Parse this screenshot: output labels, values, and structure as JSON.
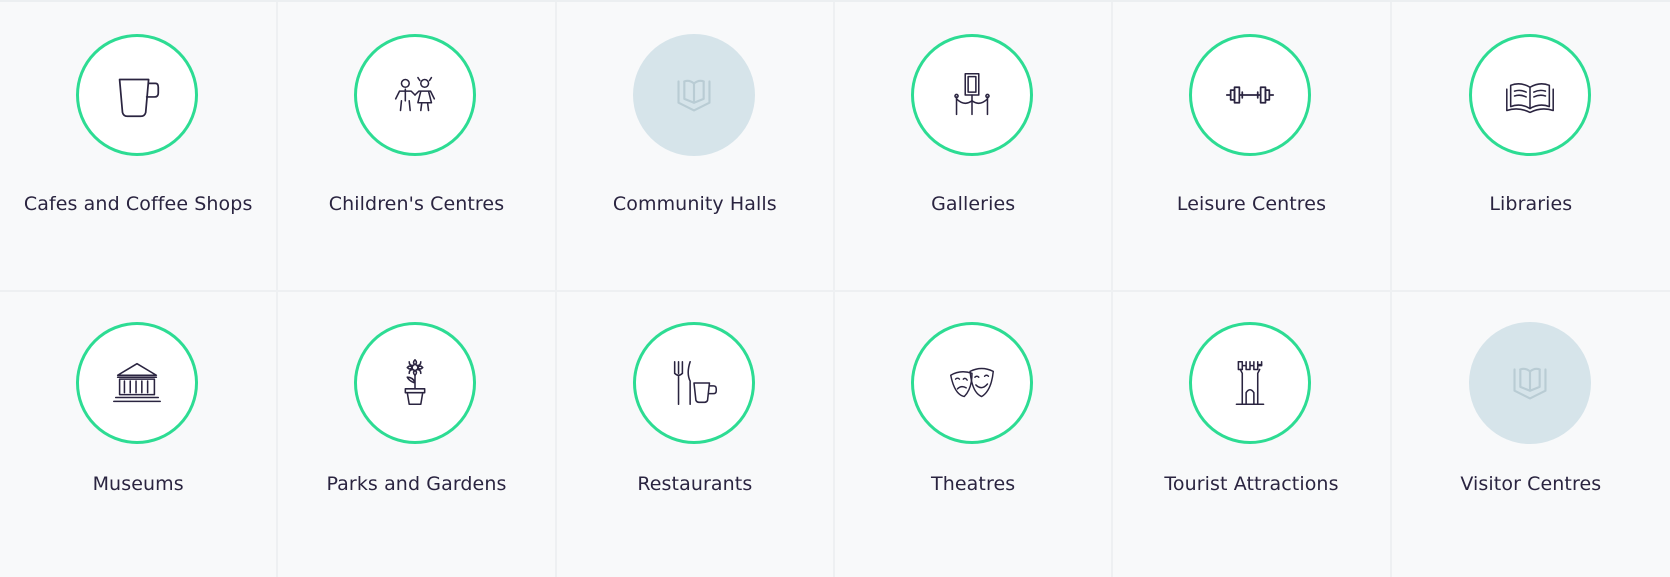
{
  "colors": {
    "ring": "#2ddc93",
    "placeholder": "#d6e4ea",
    "text": "#2a2440",
    "tile_bg": "#f8f9fa"
  },
  "categories": [
    {
      "label": "Cafes and Coffee Shops",
      "icon": "coffee-cup-icon"
    },
    {
      "label": "Children's Centres",
      "icon": "children-icon"
    },
    {
      "label": "Community Halls",
      "icon": "book-placeholder-icon"
    },
    {
      "label": "Galleries",
      "icon": "gallery-frame-icon"
    },
    {
      "label": "Leisure Centres",
      "icon": "dumbbell-icon"
    },
    {
      "label": "Libraries",
      "icon": "open-book-icon"
    },
    {
      "label": "Museums",
      "icon": "museum-building-icon"
    },
    {
      "label": "Parks and Gardens",
      "icon": "flower-pot-icon"
    },
    {
      "label": "Restaurants",
      "icon": "cutlery-cup-icon"
    },
    {
      "label": "Theatres",
      "icon": "theatre-masks-icon"
    },
    {
      "label": "Tourist Attractions",
      "icon": "castle-tower-icon"
    },
    {
      "label": "Visitor Centres",
      "icon": "book-placeholder-icon"
    }
  ]
}
